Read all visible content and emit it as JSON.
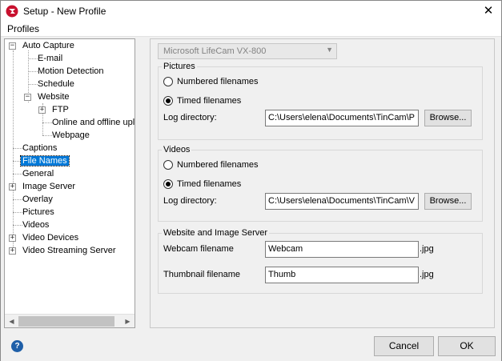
{
  "window": {
    "title": "Setup - New Profile",
    "close_glyph": "✕"
  },
  "menu": {
    "profiles": "Profiles"
  },
  "tree": {
    "items": [
      {
        "label": "Auto Capture"
      },
      {
        "label": "E-mail"
      },
      {
        "label": "Motion Detection"
      },
      {
        "label": "Schedule"
      },
      {
        "label": "Website"
      },
      {
        "label": "FTP"
      },
      {
        "label": "Online and offline uplc"
      },
      {
        "label": "Webpage"
      },
      {
        "label": "Captions"
      },
      {
        "label": "File Names"
      },
      {
        "label": "General"
      },
      {
        "label": "Image Server"
      },
      {
        "label": "Overlay"
      },
      {
        "label": "Pictures"
      },
      {
        "label": "Videos"
      },
      {
        "label": "Video Devices"
      },
      {
        "label": "Video Streaming Server"
      }
    ],
    "expander_minus": "−",
    "expander_plus": "+",
    "selected": "File Names"
  },
  "device_select": {
    "value": "Microsoft LifeCam VX-800"
  },
  "pictures": {
    "title": "Pictures",
    "numbered": "Numbered filenames",
    "timed": "Timed filenames",
    "log_label": "Log directory:",
    "log_value": "C:\\Users\\elena\\Documents\\TinCam\\P",
    "browse": "Browse..."
  },
  "videos": {
    "title": "Videos",
    "numbered": "Numbered filenames",
    "timed": "Timed filenames",
    "log_label": "Log directory:",
    "log_value": "C:\\Users\\elena\\Documents\\TinCam\\V",
    "browse": "Browse..."
  },
  "website": {
    "title": "Website and Image Server",
    "webcam_label": "Webcam filename",
    "webcam_value": "Webcam",
    "webcam_ext": ".jpg",
    "thumb_label": "Thumbnail filename",
    "thumb_value": "Thumb",
    "thumb_ext": ".jpg"
  },
  "footer": {
    "help": "?",
    "cancel": "Cancel",
    "ok": "OK"
  },
  "colors": {
    "selection": "#0078d7",
    "help_icon": "#1f5fa8"
  }
}
